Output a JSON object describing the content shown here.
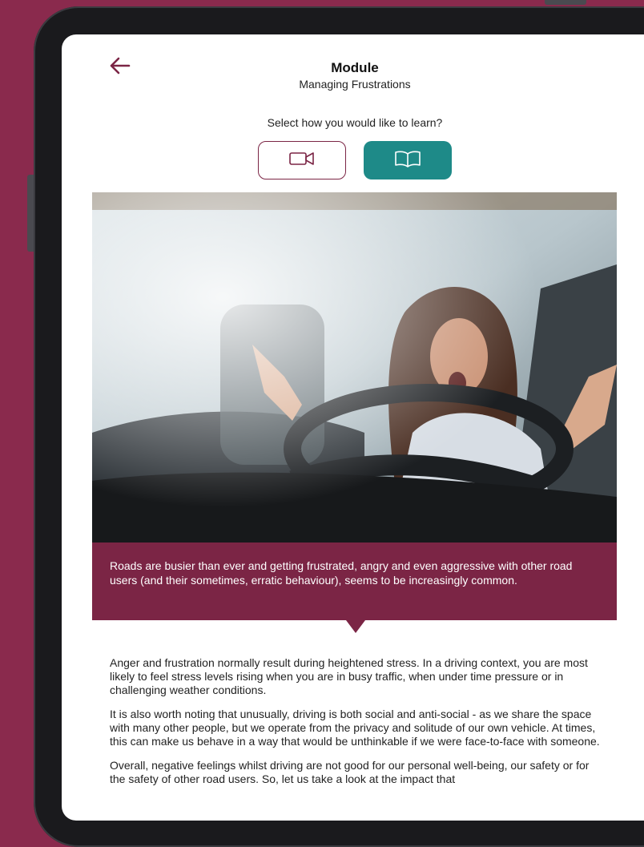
{
  "header": {
    "title": "Module",
    "subtitle": "Managing Frustrations"
  },
  "learn_prompt": "Select how you would like to learn?",
  "learning_modes": [
    {
      "icon": "video-camera-icon",
      "selected": false
    },
    {
      "icon": "open-book-icon",
      "selected": true
    }
  ],
  "colors": {
    "brand": "#7b2545",
    "accent": "#1e8a88",
    "background": "#8a2a4d"
  },
  "caption": "Roads are busier than ever and getting frustrated, angry and even aggressive with other road users (and their sometimes, erratic behaviour), seems to be increasingly common.",
  "paragraphs": [
    "Anger and frustration normally result during heightened stress. In a driving context, you are most likely to feel stress levels rising when you are in busy traffic, when under time pressure or in challenging weather conditions.",
    "It is also worth noting that unusually, driving is both social and anti-social - as we share the space with many other people, but we operate from the privacy and solitude of our own vehicle. At times, this can make us behave in a way that would be unthinkable if we were face-to-face with someone.",
    "Overall, negative feelings whilst driving are not good for our personal well-being, our safety or for the safety of other road users. So, let us take a look at the impact that"
  ]
}
